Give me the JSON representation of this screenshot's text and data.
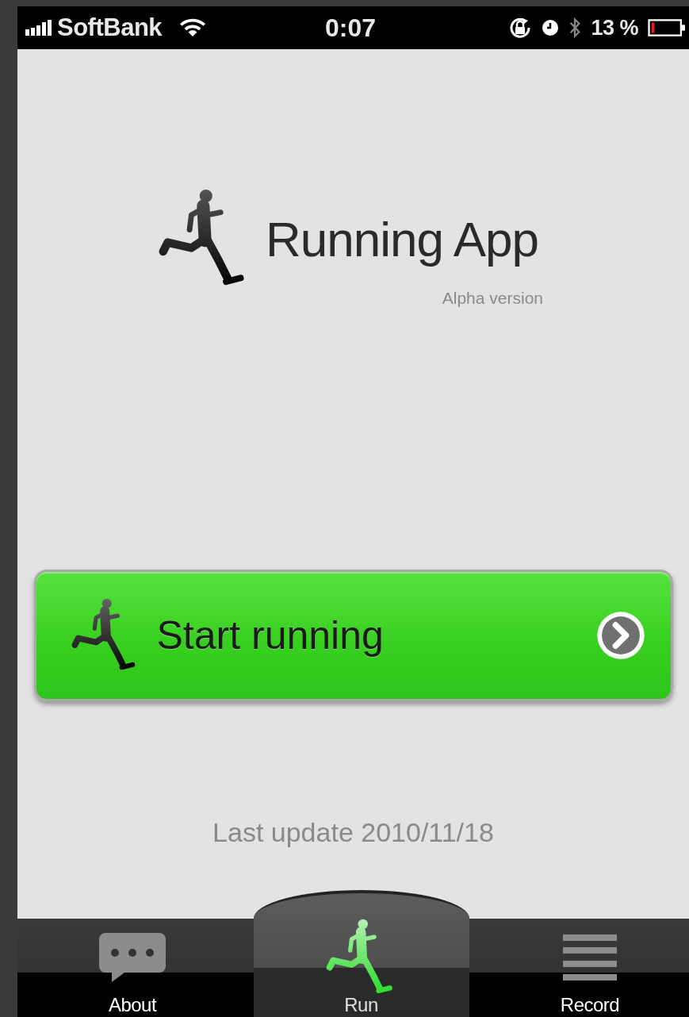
{
  "status_bar": {
    "carrier": "SoftBank",
    "time": "0:07",
    "battery": "13 %"
  },
  "title": "Running App",
  "subtitle": "Alpha version",
  "start_button": {
    "label": "Start running"
  },
  "last_update": "Last update 2010/11/18",
  "tabs": [
    {
      "label": "About",
      "selected": false
    },
    {
      "label": "Run",
      "selected": true
    },
    {
      "label": "Record",
      "selected": false
    }
  ]
}
